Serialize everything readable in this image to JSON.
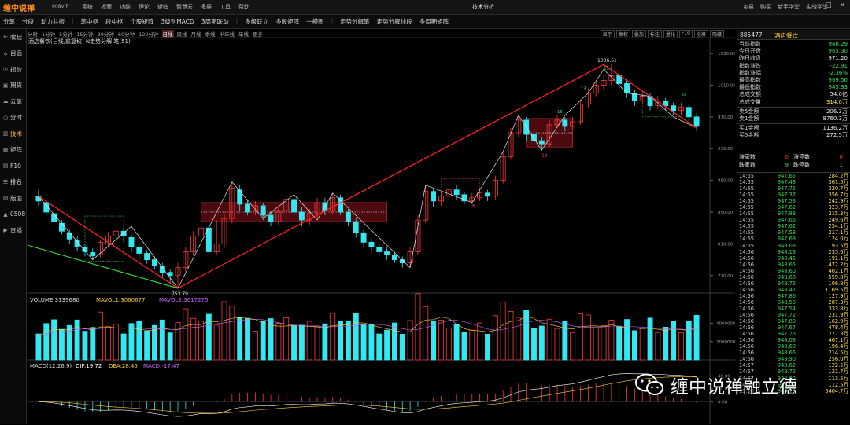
{
  "app": {
    "logo": "缠中说禅",
    "edition": "608VIP",
    "menu": [
      "系统",
      "板面",
      "功能",
      "理论",
      "矩阵",
      "智慧云",
      "多屏",
      "工具",
      "帮助"
    ],
    "center_title": "技术分析",
    "right_menu": [
      "炎易",
      "购买",
      "新手学堂",
      "实战学堂"
    ],
    "win_buttons": [
      "—",
      "□",
      "×"
    ]
  },
  "toolbar": {
    "items": [
      "分笔",
      "分段",
      "动力共振",
      "|",
      "笔中枢",
      "段中枢",
      "个股矩阵",
      "3级别MACD",
      "3周期联动",
      "|",
      "多级联立",
      "多股矩阵",
      "一模图",
      "|",
      "走势分解笔",
      "走势分解线段",
      "多周期矩阵"
    ]
  },
  "sidebar": [
    {
      "icon": "back-icon",
      "glyph": "←",
      "label": "收起"
    },
    {
      "icon": "home-icon",
      "glyph": "⌂",
      "label": "自选"
    },
    {
      "icon": "quote-icon",
      "glyph": "◎",
      "label": "报价"
    },
    {
      "icon": "futures-icon",
      "glyph": "▣",
      "label": "期货"
    },
    {
      "icon": "cloud-icon",
      "glyph": "☁",
      "label": "云笔"
    },
    {
      "icon": "timeshare-icon",
      "glyph": "◷",
      "label": "分时"
    },
    {
      "icon": "tech-icon",
      "glyph": "▥",
      "label": "技术",
      "active": true
    },
    {
      "icon": "matrix-icon",
      "glyph": "▦",
      "label": "矩阵"
    },
    {
      "icon": "f10-icon",
      "glyph": "▤",
      "label": "F10"
    },
    {
      "icon": "rank-icon",
      "glyph": "☰",
      "label": "排名"
    },
    {
      "icon": "board-icon",
      "glyph": "▧",
      "label": "版面"
    },
    {
      "icon": "chart-icon",
      "glyph": "▲",
      "label": "0508"
    },
    {
      "icon": "live-icon",
      "glyph": "▶",
      "label": "直播"
    }
  ],
  "periods": {
    "items": [
      "分时",
      "1分钟",
      "5分钟",
      "15分钟",
      "30分钟",
      "60分钟",
      "120分钟",
      "日线",
      "周线",
      "月线",
      "季线",
      "半年线",
      "年线",
      "更多"
    ],
    "active": "日线",
    "tools": [
      "显示",
      "复权",
      "叠加",
      "标注",
      "量化",
      "F10",
      "全屏",
      "隐藏"
    ]
  },
  "chart_head": "酒店餐饮(日线,前复权)  N走势分解  笔(51)",
  "chart_data": [
    {
      "type": "candlestick",
      "ylim": [
        745,
        1058
      ],
      "yticks": [
        1050.0,
        1010.0,
        970.0,
        930.0,
        890.0,
        850.0,
        810.0,
        770.0
      ],
      "annotations": {
        "high": "1036.51",
        "low": "753.79"
      },
      "markers": [
        {
          "label": "15",
          "near": "high"
        },
        {
          "label": "13",
          "near": "high"
        },
        {
          "label": "25",
          "near": "right"
        },
        {
          "label": "15",
          "near": "mid"
        },
        {
          "label": "18",
          "near": "pivot"
        },
        {
          "label": "8",
          "near": "low"
        }
      ],
      "candles": [
        [
          870,
          864,
          878,
          858
        ],
        [
          862,
          850,
          866,
          845
        ],
        [
          848,
          838,
          852,
          834
        ],
        [
          836,
          826,
          840,
          822
        ],
        [
          824,
          816,
          828,
          810
        ],
        [
          814,
          806,
          819,
          801
        ],
        [
          806,
          800,
          810,
          795
        ],
        [
          799,
          795,
          804,
          790
        ],
        [
          796,
          812,
          815,
          792
        ],
        [
          810,
          820,
          825,
          806
        ],
        [
          820,
          826,
          832,
          815
        ],
        [
          826,
          820,
          830,
          812
        ],
        [
          818,
          806,
          822,
          800
        ],
        [
          806,
          798,
          810,
          790
        ],
        [
          798,
          790,
          802,
          785
        ],
        [
          790,
          782,
          794,
          778
        ],
        [
          782,
          774,
          786,
          768
        ],
        [
          774,
          770,
          778,
          760
        ],
        [
          770,
          780,
          786,
          754
        ],
        [
          780,
          800,
          806,
          775
        ],
        [
          800,
          820,
          826,
          795
        ],
        [
          820,
          830,
          836,
          812
        ],
        [
          830,
          800,
          836,
          795
        ],
        [
          800,
          810,
          840,
          796
        ],
        [
          810,
          842,
          848,
          805
        ],
        [
          842,
          880,
          888,
          836
        ],
        [
          878,
          860,
          884,
          852
        ],
        [
          860,
          850,
          866,
          846
        ],
        [
          852,
          858,
          864,
          846
        ],
        [
          858,
          846,
          862,
          840
        ],
        [
          846,
          838,
          852,
          832
        ],
        [
          838,
          852,
          858,
          834
        ],
        [
          852,
          866,
          872,
          846
        ],
        [
          866,
          850,
          870,
          844
        ],
        [
          850,
          840,
          856,
          832
        ],
        [
          840,
          848,
          854,
          834
        ],
        [
          848,
          862,
          868,
          842
        ],
        [
          862,
          852,
          868,
          846
        ],
        [
          852,
          868,
          874,
          848
        ],
        [
          868,
          850,
          872,
          846
        ],
        [
          850,
          838,
          854,
          832
        ],
        [
          838,
          824,
          842,
          818
        ],
        [
          824,
          812,
          828,
          806
        ],
        [
          812,
          806,
          816,
          800
        ],
        [
          806,
          800,
          810,
          794
        ],
        [
          800,
          796,
          806,
          790
        ],
        [
          796,
          790,
          800,
          786
        ],
        [
          790,
          786,
          794,
          780
        ],
        [
          786,
          800,
          806,
          780
        ],
        [
          800,
          840,
          846,
          796
        ],
        [
          840,
          876,
          884,
          836
        ],
        [
          876,
          864,
          880,
          856
        ],
        [
          864,
          870,
          876,
          858
        ],
        [
          870,
          878,
          884,
          864
        ],
        [
          878,
          872,
          884,
          866
        ],
        [
          872,
          864,
          876,
          860
        ],
        [
          864,
          868,
          874,
          860
        ],
        [
          868,
          874,
          880,
          864
        ],
        [
          874,
          870,
          878,
          864
        ],
        [
          870,
          890,
          896,
          866
        ],
        [
          890,
          920,
          926,
          886
        ],
        [
          920,
          950,
          956,
          916
        ],
        [
          950,
          966,
          972,
          944
        ],
        [
          966,
          948,
          970,
          940
        ],
        [
          948,
          940,
          952,
          932
        ],
        [
          940,
          936,
          944,
          928
        ],
        [
          936,
          960,
          966,
          932
        ],
        [
          960,
          966,
          972,
          956
        ],
        [
          966,
          958,
          970,
          952
        ],
        [
          958,
          964,
          970,
          954
        ],
        [
          964,
          986,
          992,
          960
        ],
        [
          986,
          1000,
          1006,
          982
        ],
        [
          1000,
          1010,
          1016,
          996
        ],
        [
          1010,
          1016,
          1022,
          1004
        ],
        [
          1016,
          1022,
          1036,
          1010
        ],
        [
          1022,
          1012,
          1028,
          1006
        ],
        [
          1012,
          1000,
          1018,
          994
        ],
        [
          1000,
          990,
          1004,
          984
        ],
        [
          990,
          996,
          1002,
          986
        ],
        [
          996,
          984,
          1000,
          978
        ],
        [
          984,
          990,
          996,
          980
        ],
        [
          990,
          984,
          994,
          978
        ],
        [
          984,
          978,
          988,
          972
        ],
        [
          978,
          982,
          986,
          972
        ],
        [
          982,
          970,
          986,
          964
        ],
        [
          970,
          958,
          974,
          952
        ]
      ]
    },
    {
      "type": "bar",
      "title": "VOL",
      "labels": {
        "vol": "VOLUME:3139680",
        "ma1": "MAVOL1:3060677",
        "ma2": "MAVOL2:3617275"
      },
      "yticks": [
        4000000,
        2000000
      ],
      "ylim": [
        0,
        5600000
      ]
    },
    {
      "type": "bar",
      "title": "MACD",
      "labels": {
        "name": "MACD(12,26,9)",
        "dif": "DIF:19.72",
        "dea": "DEA:28.45",
        "macd": "MACD:-17.47"
      },
      "yticks": [
        40.0,
        20.0,
        0.0
      ],
      "ylim": [
        -32,
        50
      ]
    }
  ],
  "stock": {
    "code": "885477",
    "name": "酒店餐饮"
  },
  "info": [
    {
      "label": "当前指数",
      "value": "948.29",
      "cls": "dn"
    },
    {
      "label": "今日开盘",
      "value": "965.30",
      "cls": "dn"
    },
    {
      "label": "昨日收盘",
      "value": "971.20",
      "cls": "wh"
    },
    {
      "label": "指数涨跌",
      "value": "-22.91",
      "cls": "dn"
    },
    {
      "label": "指数涨幅",
      "value": "-2.36%",
      "cls": "dn"
    },
    {
      "label": "最高指数",
      "value": "969.50",
      "cls": "dn"
    },
    {
      "label": "最低指数",
      "value": "945.93",
      "cls": "dn"
    },
    {
      "label": "总成交额",
      "value": "54.0亿",
      "cls": "wh"
    },
    {
      "label": "总成交量",
      "value": "314.0万",
      "cls": "yl"
    },
    {
      "sep": true
    },
    {
      "label": "卖5金额",
      "value": "206.3万",
      "cls": "wh"
    },
    {
      "label": "卖1金额",
      "value": "8760.3万",
      "cls": "wh"
    },
    {
      "sep": true
    },
    {
      "label": "买1金额",
      "value": "1136.2万",
      "cls": "wh"
    },
    {
      "label": "买5金额",
      "value": "272.5万",
      "cls": "wh"
    }
  ],
  "counts": [
    [
      {
        "label": "涨家数",
        "value": "0",
        "cls": "up"
      },
      {
        "label": "涨停数",
        "value": "0",
        "cls": "up"
      }
    ],
    [
      {
        "label": "跌家数",
        "value": "9",
        "cls": "dn"
      },
      {
        "label": "跌停数",
        "value": "1",
        "cls": "dn"
      }
    ]
  ],
  "ticks": [
    [
      "14:55",
      "947.65",
      "284.2万"
    ],
    [
      "14:55",
      "947.43",
      "361.5万"
    ],
    [
      "14:55",
      "947.75",
      "320.7万"
    ],
    [
      "14:55",
      "947.37",
      "356.7万"
    ],
    [
      "14:55",
      "947.53",
      "242.9万"
    ],
    [
      "14:55",
      "947.62",
      "323.7万"
    ],
    [
      "14:55",
      "947.83",
      "215.3万"
    ],
    [
      "14:55",
      "947.66",
      "249.6万"
    ],
    [
      "14:55",
      "947.62",
      "254.1万"
    ],
    [
      "14:55",
      "947.58",
      "217.1万"
    ],
    [
      "14:55",
      "947.68",
      "124.0万"
    ],
    [
      "14:55",
      "948.03",
      "193.5万"
    ],
    [
      "14:56",
      "948.13",
      "235.6万"
    ],
    [
      "14:56",
      "948.45",
      "191.1万"
    ],
    [
      "14:56",
      "948.65",
      "472.2万"
    ],
    [
      "14:56",
      "948.60",
      "402.1万"
    ],
    [
      "14:56",
      "948.68",
      "559.8万"
    ],
    [
      "14:56",
      "948.76",
      "106.8万"
    ],
    [
      "14:56",
      "948.47",
      "1169.5万"
    ],
    [
      "14:56",
      "947.86",
      "127.9万"
    ],
    [
      "14:56",
      "948.50",
      "287.3万"
    ],
    [
      "14:56",
      "947.54",
      "333.8万"
    ],
    [
      "14:56",
      "947.72",
      "231.9万"
    ],
    [
      "14:56",
      "947.80",
      "162.9万"
    ],
    [
      "14:56",
      "947.67",
      "478.4万"
    ],
    [
      "14:56",
      "947.76",
      "277.3万"
    ],
    [
      "14:56",
      "948.03",
      "467.1万"
    ],
    [
      "14:56",
      "948.68",
      "196.4万"
    ],
    [
      "14:56",
      "948.66",
      "214.5万"
    ],
    [
      "14:56",
      "948.90",
      "256.0万"
    ],
    [
      "14:57",
      "948.62",
      "122.5万"
    ],
    [
      "14:57",
      "948.72",
      "121.7万"
    ],
    [
      "14:57",
      "948.92",
      "113.5万"
    ],
    [
      "14:57",
      "948.79",
      "112.5万"
    ],
    [
      "15:00",
      "948.29",
      "5404.7万"
    ]
  ],
  "watermark": {
    "text": "缠中说禅融立德",
    "icon": "wechat-icon"
  }
}
